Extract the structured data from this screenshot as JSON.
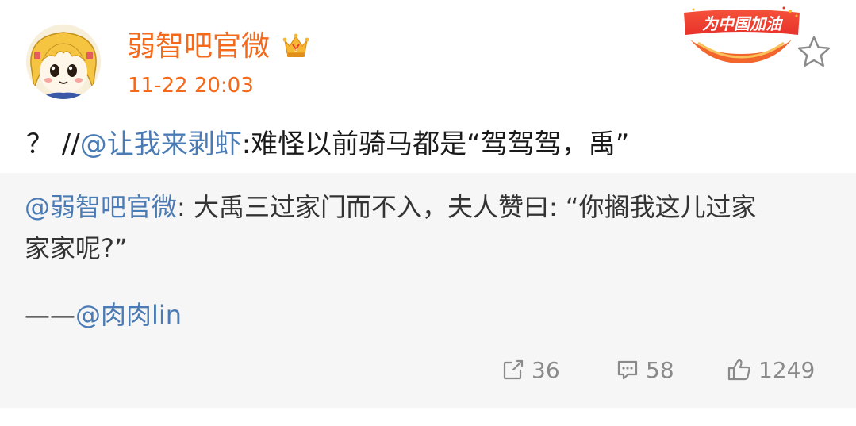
{
  "post": {
    "username": "弱智吧官微",
    "timestamp": "11-22 20:03",
    "badge_text": "为中国加油",
    "main_text": {
      "prefix": "？ //",
      "mention": "@让我来剥虾",
      "content": ":难怪以前骑马都是“驾驾驾，禹”"
    },
    "quote": {
      "mention": "@弱智吧官微",
      "line1_text": ": 大禹三过家门而不入，夫人赞曰: “你搁我这儿过家",
      "line2_text": "家家呢?”",
      "signoff_dash": "——",
      "signoff_mention": "@肉肉lin"
    },
    "actions": {
      "repost_count": "36",
      "comment_count": "58",
      "like_count": "1249"
    }
  },
  "colors": {
    "username": "#f56a1a",
    "mention": "#4a7bb5",
    "quote_bg": "#f6f6f6",
    "action_gray": "#8a8a8a"
  },
  "icons": {
    "vip": "crown-vip-icon",
    "favorite": "star-outline-icon",
    "repost": "repost-icon",
    "comment": "comment-icon",
    "like": "thumbs-up-icon"
  }
}
